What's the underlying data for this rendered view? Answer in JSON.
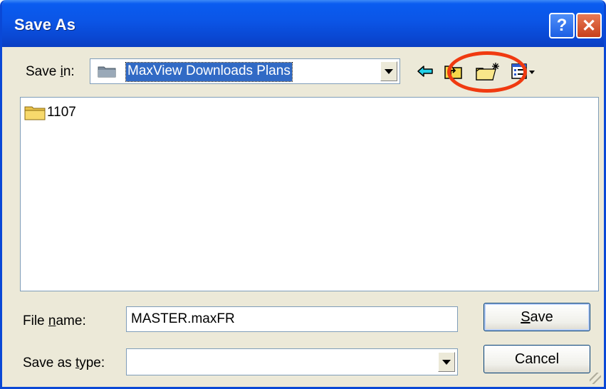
{
  "window": {
    "title": "Save As",
    "help_glyph": "?",
    "close_glyph": "✕"
  },
  "save_in": {
    "label_pre": "Save ",
    "label_accel": "i",
    "label_post": "n:",
    "value": "MaxView Downloads Plans"
  },
  "toolbar": {
    "icons": [
      "back-arrow-icon",
      "up-one-level-icon",
      "create-new-folder-icon",
      "view-menu-icon"
    ]
  },
  "files": [
    {
      "name": "1107",
      "icon": "folder-icon"
    }
  ],
  "file_name": {
    "label_pre": "File ",
    "label_accel": "n",
    "label_post": "ame:",
    "value": "MASTER.maxFR"
  },
  "save_as_type": {
    "label_pre": "Save as ",
    "label_accel": "t",
    "label_post": "ype:",
    "value": ""
  },
  "buttons": {
    "save_accel": "S",
    "save_rest": "ave",
    "cancel": "Cancel"
  },
  "colors": {
    "titlebar": "#0a55e6",
    "dialog_bg": "#ece9d8",
    "selection": "#316ac5",
    "annotation_circle": "#f03a10"
  }
}
